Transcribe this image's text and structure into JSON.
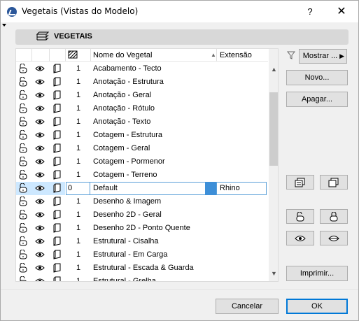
{
  "window": {
    "title": "Vegetais (Vistas do Modelo)",
    "help_label": "?",
    "close_label": "✕"
  },
  "header": {
    "label": "VEGETAIS"
  },
  "list": {
    "columns": {
      "name": "Nome do Vegetal",
      "extension": "Extensão"
    },
    "rows": [
      {
        "id": "1",
        "name": "Acabamento - Tecto",
        "ext": ""
      },
      {
        "id": "1",
        "name": "Anotação - Estrutura",
        "ext": ""
      },
      {
        "id": "1",
        "name": "Anotação - Geral",
        "ext": ""
      },
      {
        "id": "1",
        "name": "Anotação - Rótulo",
        "ext": ""
      },
      {
        "id": "1",
        "name": "Anotação - Texto",
        "ext": ""
      },
      {
        "id": "1",
        "name": "Cotagem - Estrutura",
        "ext": ""
      },
      {
        "id": "1",
        "name": "Cotagem - Geral",
        "ext": ""
      },
      {
        "id": "1",
        "name": "Cotagem - Pormenor",
        "ext": ""
      },
      {
        "id": "1",
        "name": "Cotagem - Terreno",
        "ext": ""
      },
      {
        "id": "0",
        "name": "Default",
        "ext": "Rhino",
        "selected": true
      },
      {
        "id": "1",
        "name": "Desenho & Imagem",
        "ext": ""
      },
      {
        "id": "1",
        "name": "Desenho 2D - Geral",
        "ext": ""
      },
      {
        "id": "1",
        "name": "Desenho 2D - Ponto Quente",
        "ext": ""
      },
      {
        "id": "1",
        "name": "Estrutural - Cisalha",
        "ext": ""
      },
      {
        "id": "1",
        "name": "Estrutural - Em Carga",
        "ext": ""
      },
      {
        "id": "1",
        "name": "Estrutural - Escada & Guarda",
        "ext": ""
      },
      {
        "id": "1",
        "name": "Estrutural - Grelha",
        "ext": ""
      }
    ]
  },
  "buttons": {
    "mostrar": "Mostrar ...",
    "novo": "Novo...",
    "apagar": "Apagar...",
    "imprimir": "Imprimir...",
    "cancelar": "Cancelar",
    "ok": "OK"
  },
  "colors": {
    "selection": "#cde8ff",
    "accent": "#0078d7"
  }
}
